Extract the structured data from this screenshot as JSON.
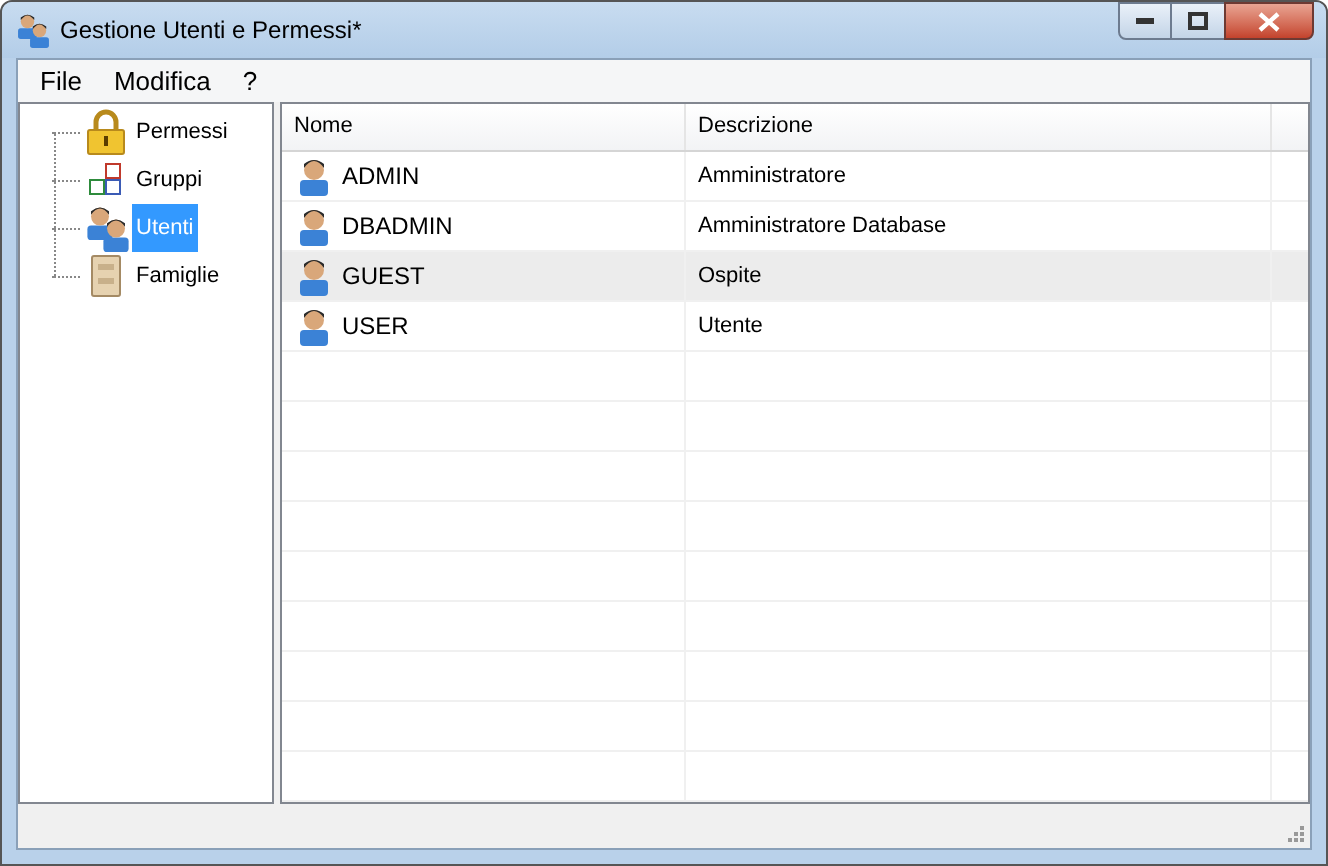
{
  "window": {
    "title": "Gestione Utenti e Permessi*"
  },
  "menu": [
    "File",
    "Modifica",
    "?"
  ],
  "tree": [
    {
      "label": "Permessi",
      "kind": "lock",
      "selected": false
    },
    {
      "label": "Gruppi",
      "kind": "groups",
      "selected": false
    },
    {
      "label": "Utenti",
      "kind": "users",
      "selected": true
    },
    {
      "label": "Famiglie",
      "kind": "cabinet",
      "selected": false
    }
  ],
  "table": {
    "columns": [
      "Nome",
      "Descrizione"
    ],
    "rows": [
      {
        "cells": [
          "ADMIN",
          "Amministratore"
        ],
        "selected": false
      },
      {
        "cells": [
          "DBADMIN",
          "Amministratore Database"
        ],
        "selected": false
      },
      {
        "cells": [
          "GUEST",
          "Ospite"
        ],
        "selected": true
      },
      {
        "cells": [
          "USER",
          "Utente"
        ],
        "selected": false
      }
    ]
  }
}
